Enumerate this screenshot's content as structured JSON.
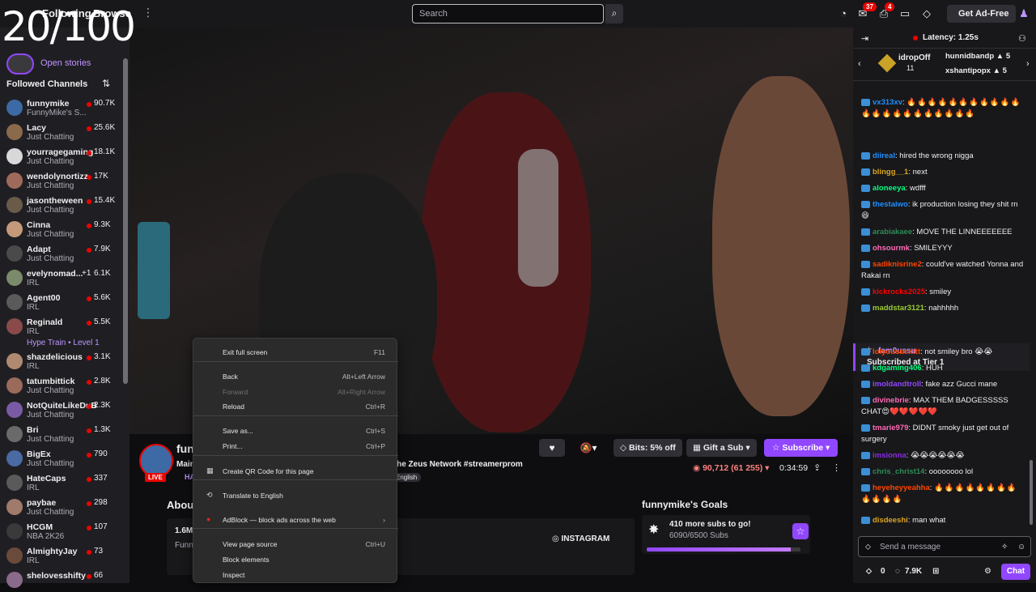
{
  "overlay": {
    "counter": "20/100"
  },
  "topnav": {
    "following": "Following",
    "browse": "Browse",
    "more": "⋮",
    "search_placeholder": "Search",
    "notif_badge": "37",
    "inbox_badge": "4",
    "get_adfree": "Get Ad-Free"
  },
  "sidebar": {
    "stories": "Open stories",
    "header": "Followed Channels",
    "channels": [
      {
        "name": "funnymike",
        "sub": "FunnyMike's S...",
        "count": "90.7K",
        "color": "#3d6aa4"
      },
      {
        "name": "Lacy",
        "sub": "Just Chatting",
        "count": "25.6K",
        "color": "#8a6a4a"
      },
      {
        "name": "yourragegaming",
        "sub": "Just Chatting",
        "count": "18.1K",
        "color": "#d8d8d8"
      },
      {
        "name": "wendolynortizz",
        "sub": "Just Chatting",
        "count": "17K",
        "color": "#a06a5a"
      },
      {
        "name": "jasontheween",
        "sub": "Just Chatting",
        "count": "15.4K",
        "color": "#6a5a4a"
      },
      {
        "name": "Cinna",
        "sub": "Just Chatting",
        "count": "9.3K",
        "color": "#c49a7a"
      },
      {
        "name": "Adapt",
        "sub": "Just Chatting",
        "count": "7.9K",
        "color": "#4a4a4a"
      },
      {
        "name": "evelynomad...",
        "sub": "IRL",
        "count": "6.1K",
        "extra": "+1",
        "color": "#7a8a6a"
      },
      {
        "name": "Agent00",
        "sub": "IRL",
        "count": "5.6K",
        "color": "#5a5a5a"
      },
      {
        "name": "Reginald",
        "sub": "IRL",
        "count": "5.5K",
        "color": "#8a4a4a"
      },
      {
        "name": "shazdelicious",
        "sub": "IRL",
        "count": "3.1K",
        "color": "#b08a70"
      },
      {
        "name": "tatumbittick",
        "sub": "Just Chatting",
        "count": "2.8K",
        "color": "#9a6a5a"
      },
      {
        "name": "NotQuiteLikeDuB",
        "sub": "Just Chatting",
        "count": "2.3K",
        "color": "#7a5aa4"
      },
      {
        "name": "Bri",
        "sub": "Just Chatting",
        "count": "1.3K",
        "color": "#6a6a6a"
      },
      {
        "name": "BigEx",
        "sub": "Just Chatting",
        "count": "790",
        "color": "#4a6aa4"
      },
      {
        "name": "HateCaps",
        "sub": "IRL",
        "count": "337",
        "color": "#5a5a5a"
      },
      {
        "name": "paybae",
        "sub": "Just Chatting",
        "count": "298",
        "color": "#a07a6a"
      },
      {
        "name": "HCGM",
        "sub": "NBA 2K26",
        "count": "107",
        "color": "#3a3a3a"
      },
      {
        "name": "AlmightyJay",
        "sub": "IRL",
        "count": "73",
        "color": "#6a4a3a"
      },
      {
        "name": "shelovesshifty",
        "sub": "",
        "count": "66",
        "color": "#8a6a8a"
      }
    ],
    "hype_train": "Hype Train • Level 1"
  },
  "stream": {
    "channel_name": "funnymike",
    "title_left": "Main",
    "title_right": "The Zeus Network #streamerprom",
    "category": "HA",
    "tag": "English",
    "live": "LIVE",
    "bits": "Bits: 5% off",
    "gift": "Gift a Sub",
    "subscribe": "Subscribe",
    "viewers": "90,712 (61 255)",
    "uptime": "0:34:59",
    "about_heading": "About",
    "about_followers": "1.6M",
    "about_desc": "Funn",
    "instagram": "INSTAGRAM",
    "goals_heading": "funnymike's Goals",
    "goals_title": "410 more subs to go!",
    "goals_sub": "6090/6500 Subs",
    "goals_progress": 0.937
  },
  "context_menu": [
    {
      "label": "Exit full screen",
      "shortcut": "F11"
    },
    {
      "label": "Back",
      "shortcut": "Alt+Left Arrow"
    },
    {
      "label": "Forward",
      "shortcut": "Alt+Right Arrow",
      "disabled": true
    },
    {
      "label": "Reload",
      "shortcut": "Ctrl+R"
    },
    {
      "label": "Save as...",
      "shortcut": "Ctrl+S"
    },
    {
      "label": "Print...",
      "shortcut": "Ctrl+P"
    },
    {
      "label": "Create QR Code for this page",
      "shortcut": ""
    },
    {
      "label": "Translate to English",
      "shortcut": ""
    },
    {
      "label": "AdBlock — block ads across the web",
      "shortcut": "›"
    },
    {
      "label": "View page source",
      "shortcut": "Ctrl+U"
    },
    {
      "label": "Block elements",
      "shortcut": ""
    },
    {
      "label": "Inspect",
      "shortcut": ""
    }
  ],
  "chat": {
    "latency": "Latency: 1.25s",
    "leader1": "idropOff",
    "leader1_count": "11",
    "leader2": "hunnidbandp",
    "leader2_count": "5",
    "leader3": "xshantipopx",
    "leader3_count": "5",
    "messages": [
      {
        "user": "vx313xv",
        "color": "#1e90ff",
        "text": "🔥🔥🔥🔥🔥🔥🔥🔥🔥🔥🔥🔥🔥🔥🔥🔥🔥🔥🔥🔥🔥🔥"
      },
      {
        "user": "diireal",
        "color": "#1e90ff",
        "text": "hired the wrong nigga"
      },
      {
        "user": "blingg__1",
        "color": "#daa520",
        "text": "next"
      },
      {
        "user": "aloneeya",
        "color": "#00ff7f",
        "text": "wdfff"
      },
      {
        "user": "thestaiwo",
        "color": "#1e90ff",
        "text": "ik production losing they shit rn 😆"
      },
      {
        "user": "arabiakaee",
        "color": "#2e8b57",
        "text": "MOVE THE LINNEEEEEEE"
      },
      {
        "user": "ohsourmk",
        "color": "#ff69b4",
        "text": "SMILEYYY"
      },
      {
        "user": "sadiknisrine2",
        "color": "#ff4500",
        "text": "could've watched Yonna and Rakai rn"
      },
      {
        "user": "kickrocks2025",
        "color": "#ff0000",
        "text": "smiley"
      },
      {
        "user": "maddstar3121",
        "color": "#9acd32",
        "text": "nahhhhh"
      },
      {
        "user": "lolyousuckttt",
        "color": "#ff4500",
        "text": "not smiley bro 😭😭"
      },
      {
        "user": "kdgaming406",
        "color": "#00ff7f",
        "text": "HUH"
      },
      {
        "user": "imoldandtroll",
        "color": "#9147ff",
        "text": "fake azz Gucci mane"
      },
      {
        "user": "divinebrie",
        "color": "#ff69b4",
        "text": "MAX THEM BADGESSSSS CHAT😍❤️❤️❤️❤️❤️"
      },
      {
        "user": "tmarie979",
        "color": "#ff69b4",
        "text": "DIDNT smoky just get out of surgery"
      },
      {
        "user": "imsionna",
        "color": "#8a2be2",
        "text": "😭😭😭😭😭😭"
      },
      {
        "user": "chris_christ14",
        "color": "#2e8b57",
        "text": "oooooooo lol"
      },
      {
        "user": "heyeheyyeahha",
        "color": "#ff4500",
        "text": "🔥🔥🔥🔥🔥🔥🔥🔥🔥🔥🔥🔥"
      },
      {
        "user": "disdeeshi",
        "color": "#daa520",
        "text": "man what"
      }
    ],
    "sub_user": "fam0ussu",
    "sub_text": "Subscribed at Tier 1",
    "input_placeholder": "Send a message",
    "points": "0",
    "channel_points": "7.9K",
    "chat_button": "Chat"
  }
}
